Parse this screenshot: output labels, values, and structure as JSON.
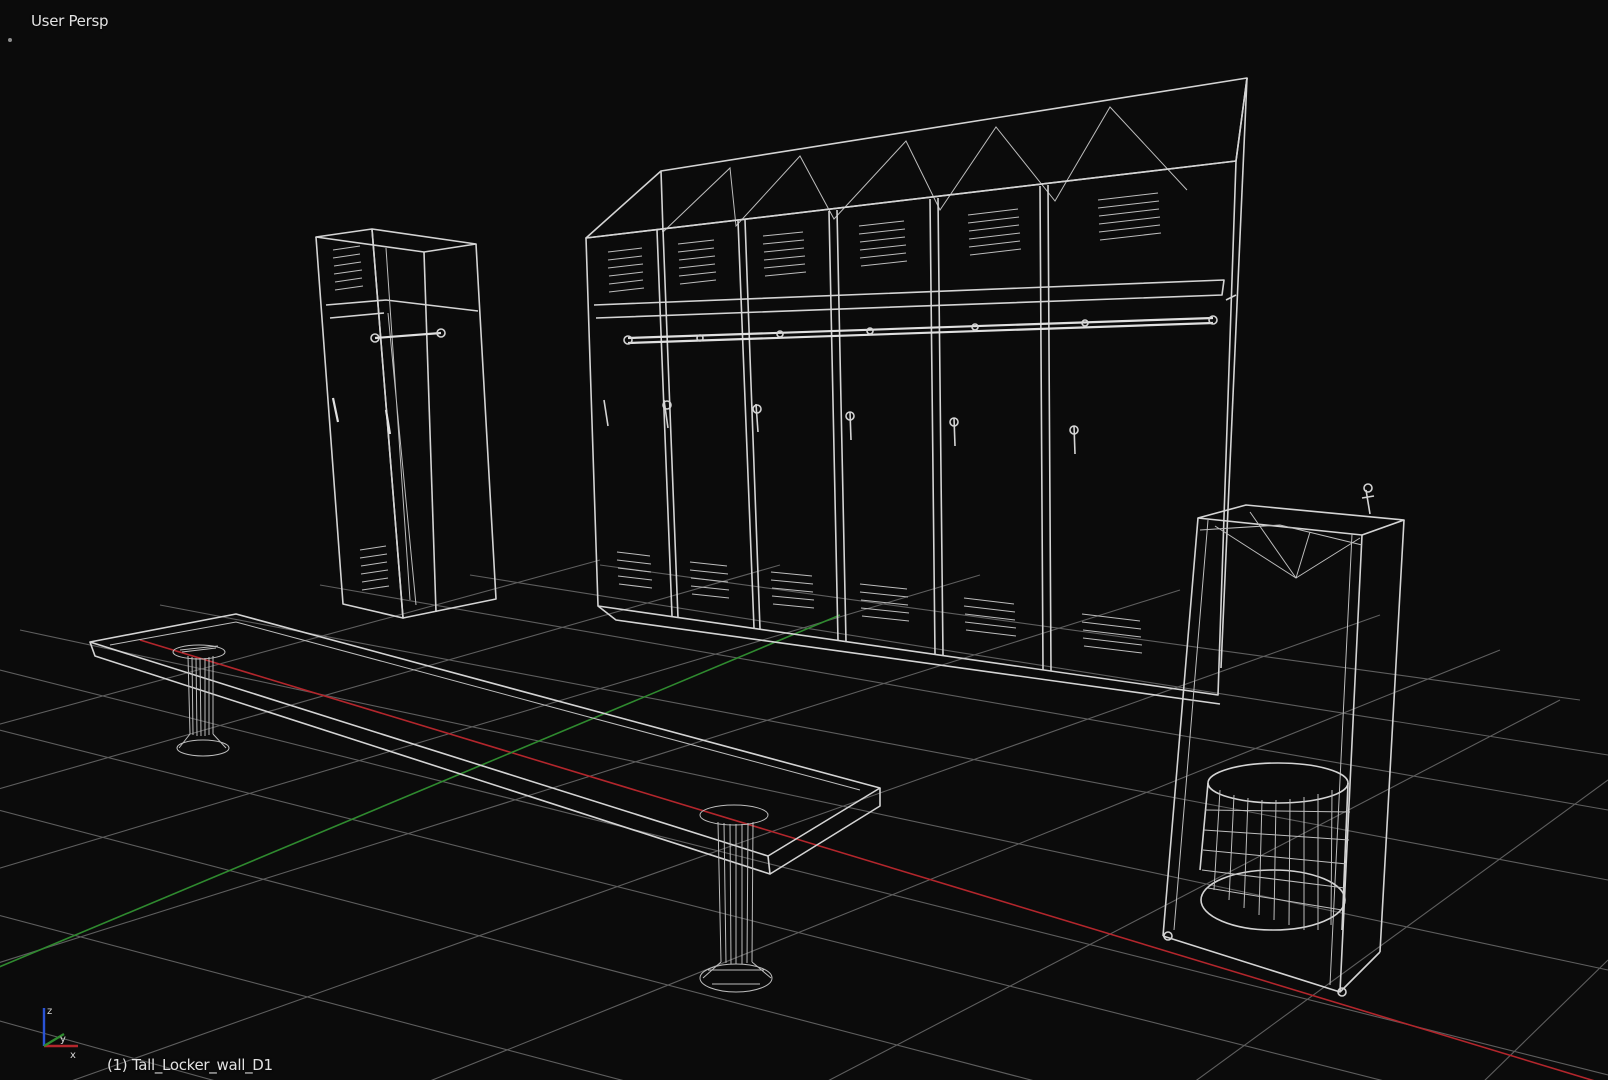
{
  "app": "Blender 3D Viewport",
  "viewport": {
    "view_name": "User Persp",
    "active_object": "(1) Tall_Locker_wall_D1",
    "shading": "wireframe"
  },
  "axes": {
    "x_color": "#b3262c",
    "y_color": "#2f8a2f",
    "z_color": "#2a53d6"
  },
  "scene_objects": [
    {
      "name": "single-locker",
      "icon": "locker"
    },
    {
      "name": "locker-wall",
      "lockers": 6,
      "icon": "locker-row"
    },
    {
      "name": "bench",
      "legs": 2,
      "icon": "bench"
    },
    {
      "name": "drinking-fountain-stand",
      "icon": "fountain"
    },
    {
      "name": "waste-basket",
      "icon": "basket"
    }
  ],
  "colors": {
    "background": "#0b0b0b",
    "grid": "#5e5e5e",
    "wire": "#d4d4d4",
    "text": "#e2e2e2"
  }
}
